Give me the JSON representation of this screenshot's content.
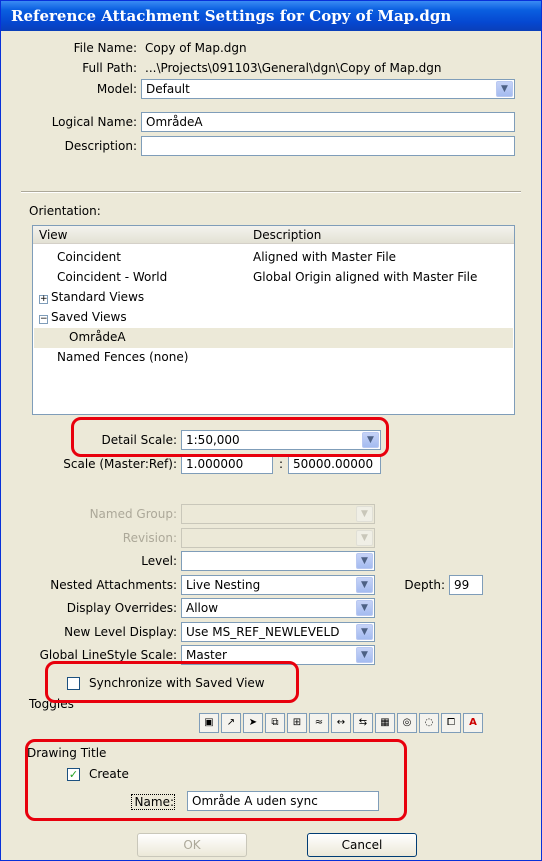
{
  "window": {
    "title": "Reference Attachment Settings for Copy of Map.dgn"
  },
  "file": {
    "file_name_label": "File Name:",
    "file_name": "Copy of Map.dgn",
    "full_path_label": "Full Path:",
    "full_path": "...\\Projects\\091103\\General\\dgn\\Copy of Map.dgn",
    "model_label": "Model:",
    "model": "Default",
    "logical_name_label": "Logical Name:",
    "logical_name": "OmrådeA",
    "description_label": "Description:",
    "description": ""
  },
  "orientation": {
    "label": "Orientation:",
    "col_view": "View",
    "col_description": "Description",
    "rows": [
      {
        "view": "Coincident",
        "description": "Aligned with Master File"
      },
      {
        "view": "Coincident - World",
        "description": "Global Origin aligned with Master File"
      },
      {
        "view": "Standard Views",
        "expander": "+"
      },
      {
        "view": "Saved Views",
        "expander": "−"
      },
      {
        "view": "OmrådeA",
        "selected": true
      },
      {
        "view": "Named Fences (none)"
      }
    ]
  },
  "scale": {
    "detail_scale_label": "Detail Scale:",
    "detail_scale": "1:50,000",
    "scale_label": "Scale (Master:Ref):",
    "master": "1.000000",
    "separator": ":",
    "ref": "50000.00000"
  },
  "attachment": {
    "named_group_label": "Named Group:",
    "named_group": "",
    "revision_label": "Revision:",
    "revision": "",
    "level_label": "Level:",
    "level": "",
    "nested_label": "Nested Attachments:",
    "nested": "Live Nesting",
    "depth_label": "Depth:",
    "depth": "99",
    "display_overrides_label": "Display Overrides:",
    "display_overrides": "Allow",
    "new_level_display_label": "New Level Display:",
    "new_level_display": "Use MS_REF_NEWLEVELD",
    "global_linestyle_label": "Global LineStyle Scale:",
    "global_linestyle": "Master",
    "sync_label": "Synchronize with Saved View"
  },
  "toggles": {
    "label": "Toggles"
  },
  "drawing_title": {
    "label": "Drawing Title",
    "create_label": "Create",
    "name_label": "Name:",
    "name": "Område A uden sync"
  },
  "buttons": {
    "ok": "OK",
    "cancel": "Cancel"
  },
  "colors": {
    "highlight_red": "#e8000d",
    "titlebar_blue": "#0548d1",
    "dialog_bg": "#ece9d8"
  }
}
